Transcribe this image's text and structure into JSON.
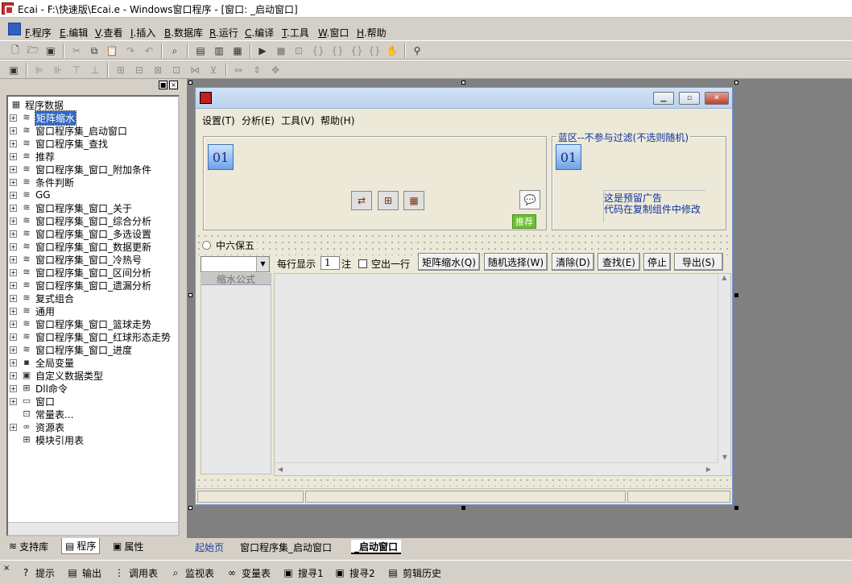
{
  "window": {
    "title": "Ecai - F:\\快速版\\Ecai.e - Windows窗口程序 - [窗口: _启动窗口]"
  },
  "menubar": [
    {
      "prefix": "F",
      "label": ".程序"
    },
    {
      "prefix": "E",
      "label": ".编辑"
    },
    {
      "prefix": "V",
      "label": ".查看"
    },
    {
      "prefix": "I",
      "label": ".插入"
    },
    {
      "prefix": "B",
      "label": ".数据库"
    },
    {
      "prefix": "R",
      "label": ".运行"
    },
    {
      "prefix": "C",
      "label": ".编译"
    },
    {
      "prefix": "T",
      "label": ".工具"
    },
    {
      "prefix": "W",
      "label": ".窗口"
    },
    {
      "prefix": "H",
      "label": ".帮助"
    }
  ],
  "tree": {
    "root": "程序数据",
    "items": [
      {
        "label": "矩阵缩水",
        "selected": true
      },
      {
        "label": "窗口程序集_启动窗口"
      },
      {
        "label": "窗口程序集_查找"
      },
      {
        "label": "推荐"
      },
      {
        "label": "窗口程序集_窗口_附加条件"
      },
      {
        "label": "条件判断"
      },
      {
        "label": "GG"
      },
      {
        "label": "窗口程序集_窗口_关于"
      },
      {
        "label": "窗口程序集_窗口_综合分析"
      },
      {
        "label": "窗口程序集_窗口_多选设置"
      },
      {
        "label": "窗口程序集_窗口_数据更新"
      },
      {
        "label": "窗口程序集_窗口_冷热号"
      },
      {
        "label": "窗口程序集_窗口_区间分析"
      },
      {
        "label": "窗口程序集_窗口_遗漏分析"
      },
      {
        "label": "复式组合"
      },
      {
        "label": "通用"
      },
      {
        "label": "窗口程序集_窗口_篮球走势"
      },
      {
        "label": "窗口程序集_窗口_红球形态走势"
      },
      {
        "label": "窗口程序集_窗口_进度"
      },
      {
        "label": "全局变量"
      },
      {
        "label": "自定义数据类型"
      },
      {
        "label": "Dll命令"
      },
      {
        "label": "窗口"
      },
      {
        "label": "常量表..."
      },
      {
        "label": "资源表"
      },
      {
        "label": "模块引用表"
      }
    ]
  },
  "left_tabs": [
    "支持库",
    "程序",
    "属性"
  ],
  "form": {
    "menu": [
      "设置(T)",
      "分析(E)",
      "工具(V)",
      "帮助(H)"
    ],
    "left_number": "01",
    "right_group_label": "蓝区--不参与过滤(不选则随机)",
    "right_number": "01",
    "ad_text_1": "这是预留广告",
    "ad_text_2": "代码在复制组件中修改",
    "recommend_tag": "推荐",
    "radio_label": "中六保五",
    "per_row_label": "每行显示",
    "per_row_value": "1",
    "note_label": "注",
    "blank_row_label": "空出一行",
    "buttons": [
      "矩阵缩水(Q)",
      "随机选择(W)",
      "清除(D)",
      "查找(E)",
      "停止",
      "导出(S)"
    ],
    "formula_header": "缩水公式"
  },
  "bottom_tabs": [
    "起始页",
    "窗口程序集_启动窗口",
    "_启动窗口"
  ],
  "bottom_bar": [
    {
      "icon": "hint-icon",
      "label": "提示"
    },
    {
      "icon": "output-icon",
      "label": "输出"
    },
    {
      "icon": "call-table-icon",
      "label": "调用表"
    },
    {
      "icon": "watch-icon",
      "label": "监视表"
    },
    {
      "icon": "variable-icon",
      "label": "变量表"
    },
    {
      "icon": "search1-icon",
      "label": "搜寻1"
    },
    {
      "icon": "search2-icon",
      "label": "搜寻2"
    },
    {
      "icon": "clip-history-icon",
      "label": "剪辑历史"
    }
  ]
}
